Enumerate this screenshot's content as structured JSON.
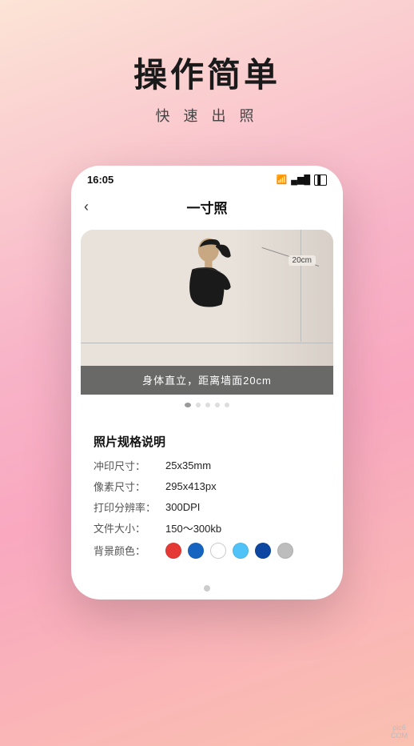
{
  "hero": {
    "title": "操作简单",
    "subtitle": "快 速 出 照"
  },
  "status_bar": {
    "time": "16:05",
    "wifi": "WiFi",
    "signal": "signal",
    "battery": "battery"
  },
  "nav": {
    "back_icon": "‹",
    "title": "一寸照"
  },
  "photo_instruction": {
    "measurement": "20cm",
    "banner_text": "身体直立，距离墙面20cm"
  },
  "dots": [
    {
      "active": true
    },
    {
      "active": false
    },
    {
      "active": false
    },
    {
      "active": false
    },
    {
      "active": false
    }
  ],
  "specs": {
    "title": "照片规格说明",
    "rows": [
      {
        "label": "冲印尺寸：",
        "value": "25x35mm"
      },
      {
        "label": "像素尺寸：",
        "value": "295x413px"
      },
      {
        "label": "打印分辨率：",
        "value": "300DPI"
      },
      {
        "label": "文件大小：",
        "value": "150～300kb"
      },
      {
        "label": "背景颜色：",
        "value": ""
      }
    ],
    "colors": [
      {
        "name": "red",
        "hex": "#e53935"
      },
      {
        "name": "blue",
        "hex": "#1565c0"
      },
      {
        "name": "white",
        "hex": "#ffffff"
      },
      {
        "name": "light-blue",
        "hex": "#4fc3f7"
      },
      {
        "name": "dark-blue",
        "hex": "#0d47a1"
      },
      {
        "name": "gray",
        "hex": "#bdbdbd"
      }
    ]
  },
  "watermark": {
    "line1": "pic6",
    "line2": "COM"
  }
}
